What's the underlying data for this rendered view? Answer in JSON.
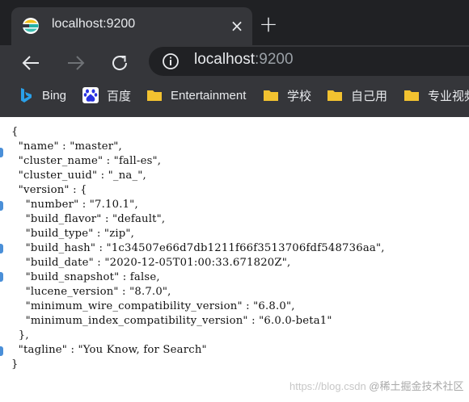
{
  "browser": {
    "tab": {
      "title": "localhost:9200",
      "close_glyph": "×"
    },
    "new_tab_glyph": "+",
    "address": {
      "host": "localhost",
      "port": ":9200"
    },
    "bookmarks": [
      {
        "label": "Bing",
        "icon": "bing-icon"
      },
      {
        "label": "百度",
        "icon": "baidu-icon"
      },
      {
        "label": "Entertainment",
        "icon": "folder-icon"
      },
      {
        "label": "学校",
        "icon": "folder-icon"
      },
      {
        "label": "自己用",
        "icon": "folder-icon"
      },
      {
        "label": "专业视频",
        "icon": "folder-icon"
      }
    ],
    "colors": {
      "chrome_dark": "#202124",
      "chrome_mid": "#35363a",
      "text": "#e8eaed",
      "folder": "#f2c230"
    }
  },
  "response_json_lines": [
    "{",
    "  \"name\" : \"master\",",
    "  \"cluster_name\" : \"fall-es\",",
    "  \"cluster_uuid\" : \"_na_\",",
    "  \"version\" : {",
    "    \"number\" : \"7.10.1\",",
    "    \"build_flavor\" : \"default\",",
    "    \"build_type\" : \"zip\",",
    "    \"build_hash\" : \"1c34507e66d7db1211f66f3513706fdf548736aa\",",
    "    \"build_date\" : \"2020-12-05T01:00:33.671820Z\",",
    "    \"build_snapshot\" : false,",
    "    \"lucene_version\" : \"8.7.0\",",
    "    \"minimum_wire_compatibility_version\" : \"6.8.0\",",
    "    \"minimum_index_compatibility_version\" : \"6.0.0-beta1\"",
    "  },",
    "  \"tagline\" : \"You Know, for Search\"",
    "}"
  ],
  "watermark": {
    "url": "https://blog.csdn",
    "brand": "@稀土掘金技术社区"
  }
}
